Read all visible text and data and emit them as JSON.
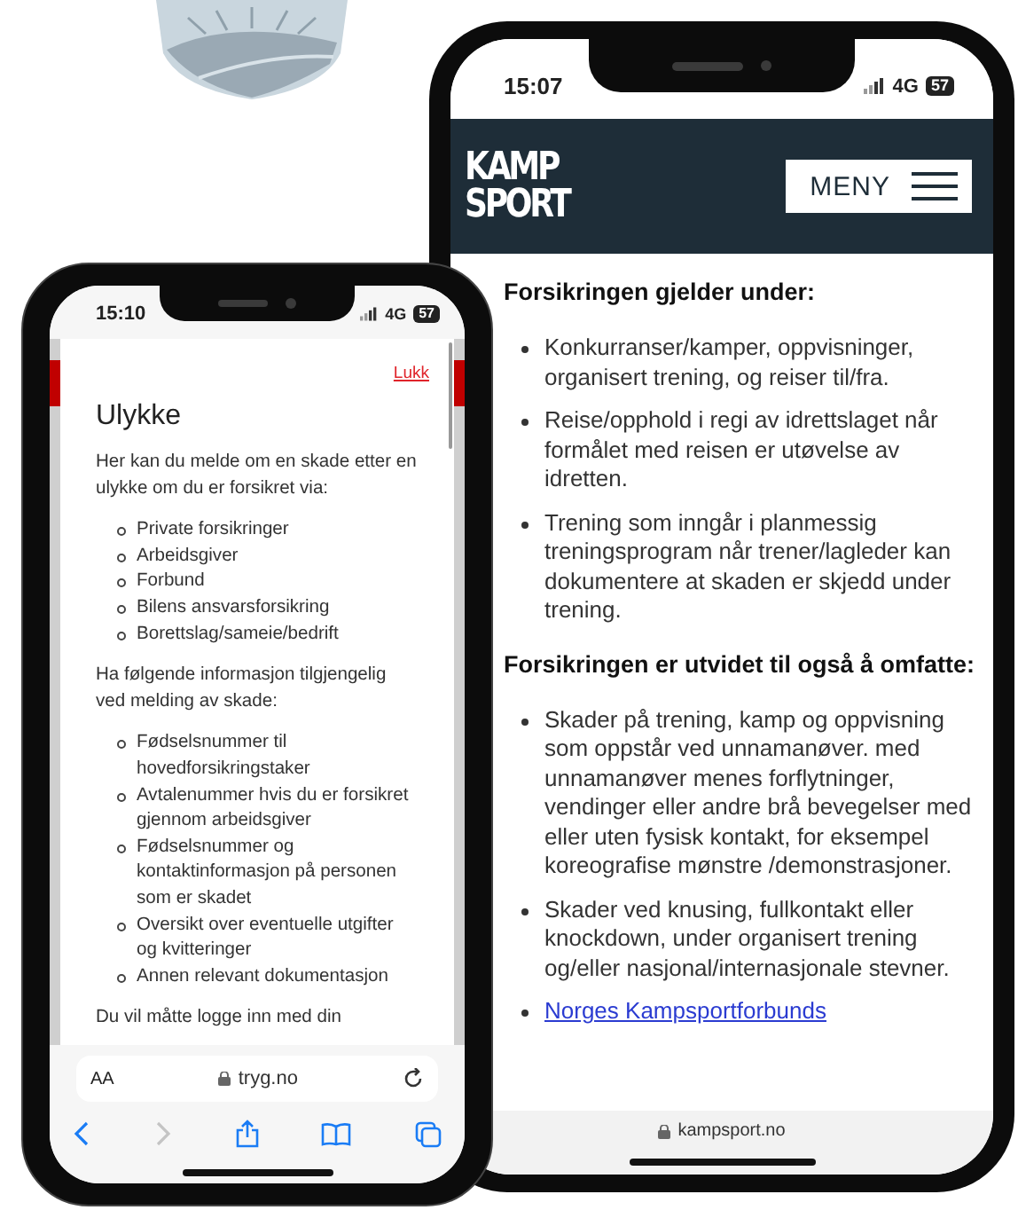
{
  "left_phone": {
    "status": {
      "time": "15:10",
      "network": "4G",
      "battery": "57"
    },
    "modal": {
      "close_link": "Lukk",
      "title": "Ulykke",
      "blocks": [
        {
          "kind": "paragraph",
          "text": "Her kan du melde om en skade etter en ulykke om du er forsikret via:"
        },
        {
          "kind": "list",
          "items": [
            "Private forsikringer",
            "Arbeidsgiver",
            "Forbund",
            "Bilens ansvarsforsikring",
            "Borettslag/sameie/bedrift"
          ]
        },
        {
          "kind": "paragraph",
          "text": "Ha følgende informasjon tilgjengelig ved melding av skade:"
        },
        {
          "kind": "list",
          "items": [
            "Fødselsnummer til hovedforsikringstaker",
            "Avtalenummer hvis du er forsikret gjennom arbeidsgiver",
            "Fødselsnummer og kontaktinformasjon på personen som er skadet",
            "Oversikt over eventuelle utgifter og kvitteringer",
            "Annen relevant dokumentasjon"
          ]
        },
        {
          "kind": "paragraph",
          "text": "Du vil måtte logge inn med din"
        }
      ]
    },
    "address_bar": {
      "text_size": "AA",
      "url": "tryg.no"
    },
    "forward_button": {
      "disabled": true
    }
  },
  "right_phone": {
    "status": {
      "time": "15:07",
      "network": "4G",
      "battery": "57"
    },
    "header": {
      "logo_lines": [
        "KAMP",
        "SPORT"
      ],
      "menu_label": "MENY"
    },
    "sections": [
      {
        "heading": "Forsikringen gjelder under:",
        "items": [
          {
            "kind": "text",
            "text": "Konkurranser/kamper, oppvisninger, organisert trening, og reiser til/fra."
          },
          {
            "kind": "text",
            "text": "Reise/opphold i regi av idrettslaget når formålet med reisen er utøvelse av idretten."
          },
          {
            "kind": "text",
            "text": "Trening som inngår i planmessig treningsprogram når trener/lagleder kan dokumentere at skaden er skjedd under trening."
          }
        ]
      },
      {
        "heading": "Forsikringen er utvidet til også å omfatte:",
        "items": [
          {
            "kind": "text",
            "text": "Skader på trening, kamp og oppvisning som oppstår ved unnamanøver. med unnamanøver menes forflytninger, vendinger eller andre brå bevegelser med eller uten fysisk kontakt, for eksempel koreografise mønstre /demonstrasjoner."
          },
          {
            "kind": "text",
            "text": "Skader ved knusing, fullkontakt eller knockdown, under organisert trening og/eller nasjonal/internasjonale stevner."
          },
          {
            "kind": "link",
            "text": "Norges Kampsportforbunds"
          }
        ]
      }
    ],
    "url": "kampsport.no"
  }
}
